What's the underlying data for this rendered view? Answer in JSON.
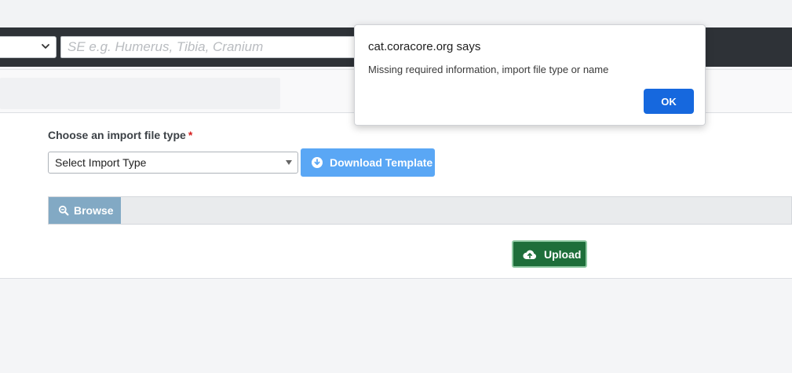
{
  "navbar": {
    "search": {
      "placeholder": "SE e.g. Humerus, Tibia, Cranium"
    }
  },
  "import_form": {
    "file_type_label": "Choose an import file type",
    "required_mark": "*",
    "select_value": "Select Import Type",
    "download_template_label": "Download Template",
    "browse_label": "Browse",
    "upload_label": "Upload"
  },
  "dialog": {
    "title": "cat.coracore.org says",
    "message": "Missing required information, import file type or name",
    "ok_label": "OK"
  },
  "colors": {
    "navbar_bg": "#2e3237",
    "download_button": "#5aa7f5",
    "browse_button": "#82a9c4",
    "upload_button": "#1e6e3a",
    "ok_button": "#1668de",
    "required": "#d61f1f"
  },
  "icons": {
    "select_chevron": "chevron-down-icon",
    "download": "download-circle-icon",
    "browse": "magnifier-icon",
    "upload": "cloud-upload-icon"
  }
}
